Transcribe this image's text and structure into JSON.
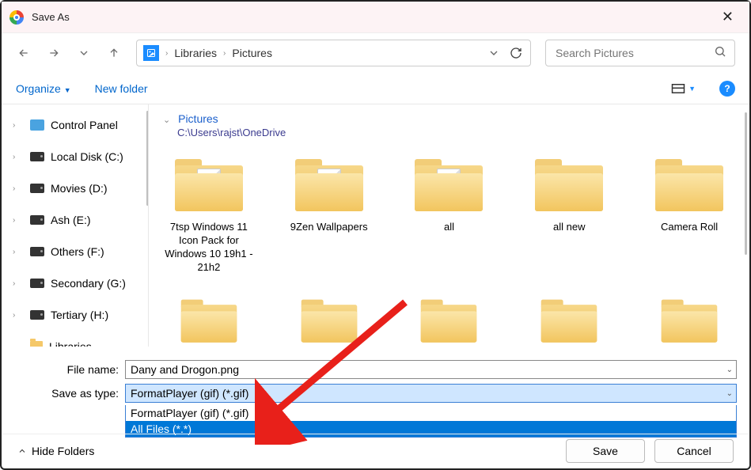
{
  "titlebar": {
    "title": "Save As"
  },
  "breadcrumb": {
    "seg1": "Libraries",
    "seg2": "Pictures"
  },
  "search": {
    "placeholder": "Search Pictures"
  },
  "toolbar": {
    "organize": "Organize",
    "newfolder": "New folder"
  },
  "sidebar": {
    "items": [
      {
        "label": "Control Panel",
        "type": "cp"
      },
      {
        "label": "Local Disk (C:)",
        "type": "drive"
      },
      {
        "label": "Movies (D:)",
        "type": "drive"
      },
      {
        "label": "Ash (E:)",
        "type": "drive"
      },
      {
        "label": "Others (F:)",
        "type": "drive"
      },
      {
        "label": "Secondary (G:)",
        "type": "drive"
      },
      {
        "label": "Tertiary (H:)",
        "type": "drive"
      },
      {
        "label": "Libraries",
        "type": "lib"
      }
    ]
  },
  "content": {
    "crumb_name": "Pictures",
    "crumb_path": "C:\\Users\\rajst\\OneDrive",
    "folders": [
      {
        "label": "7tsp Windows 11 Icon Pack for Windows 10 19h1 - 21h2",
        "doc": "plain"
      },
      {
        "label": "9Zen Wallpapers",
        "doc": "plain"
      },
      {
        "label": "all",
        "doc": "xls"
      },
      {
        "label": "all new",
        "doc": ""
      },
      {
        "label": "Camera Roll",
        "doc": ""
      }
    ]
  },
  "fields": {
    "filename_label": "File name:",
    "filename_value": "Dany and Drogon.png",
    "savetype_label": "Save as type:",
    "savetype_value": "FormatPlayer (gif) (*.gif)",
    "options": [
      "FormatPlayer (gif) (*.gif)",
      "All Files (*.*)"
    ]
  },
  "footer": {
    "hide": "Hide Folders",
    "save": "Save",
    "cancel": "Cancel"
  }
}
